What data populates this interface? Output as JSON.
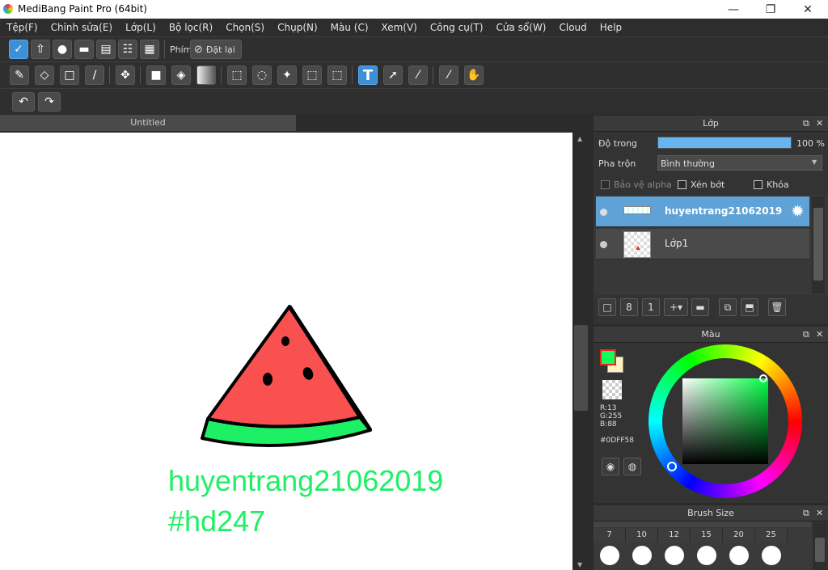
{
  "window": {
    "title": "MediBang Paint Pro (64bit)",
    "minimize": "—",
    "maximize": "❐",
    "close": "✕"
  },
  "menu": [
    "Tệp(F)",
    "Chỉnh sửa(E)",
    "Lớp(L)",
    "Bộ lọc(R)",
    "Chọn(S)",
    "Chụp(N)",
    "Màu (C)",
    "Xem(V)",
    "Công cụ(T)",
    "Cửa sổ(W)",
    "Cloud",
    "Help"
  ],
  "toolbar1": {
    "key_label": "Phím",
    "reset_label": "Đặt lại"
  },
  "tools": [
    "brush-icon",
    "eraser-icon",
    "rectangle-icon",
    "dot-brush-icon",
    "move-icon",
    "fill-rect-icon",
    "bucket-icon",
    "gradient-icon",
    "select-rect-icon",
    "lasso-icon",
    "magic-wand-icon",
    "select-pen-icon",
    "select-eraser-icon",
    "text-icon",
    "operation-icon",
    "divide-icon",
    "eyedropper-icon",
    "hand-icon"
  ],
  "selected_tool": "text-icon",
  "document": {
    "tab": "Untitled",
    "text_line1": "huyentrang21062019",
    "text_line2": "#hd247",
    "text_color": "#0DFF58"
  },
  "layer_panel": {
    "title": "Lớp",
    "opacity_label": "Độ trong",
    "opacity_value": "100 %",
    "opacity_fraction": 1.0,
    "blend_label": "Pha trộn",
    "blend_value": "Bình thường",
    "protect_alpha": "Bảo vệ alpha",
    "clipping": "Xén bớt",
    "lock": "Khóa",
    "layers": [
      {
        "name": "huyentrang21062019",
        "selected": true
      },
      {
        "name": "Lớp1",
        "selected": false
      }
    ]
  },
  "color_panel": {
    "title": "Màu",
    "r": "R:13",
    "g": "G:255",
    "b": "B:88",
    "hex": "#0DFF58",
    "foreground": "#0DFF58",
    "background": "#FFF2C0"
  },
  "brush_panel": {
    "title": "Brush Size",
    "sizes": [
      "7",
      "10",
      "12",
      "15",
      "20",
      "25"
    ]
  }
}
